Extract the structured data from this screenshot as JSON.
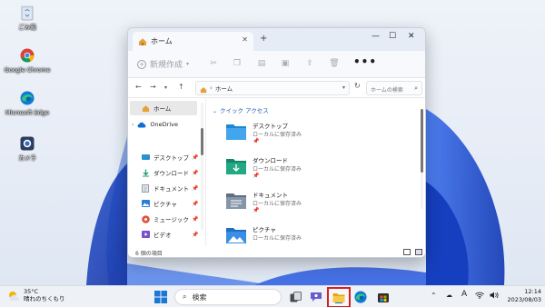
{
  "desktop_icons": [
    {
      "label": "ごみ箱",
      "icon": "recycle-bin-icon"
    },
    {
      "label": "Google Chrome",
      "icon": "chrome-icon"
    },
    {
      "label": "Microsoft Edge",
      "icon": "edge-icon"
    },
    {
      "label": "カメラ",
      "icon": "camera-icon"
    }
  ],
  "explorer": {
    "tab_title": "ホーム",
    "tab_close": "✕",
    "new_tab": "+",
    "controls": {
      "minimize": "—",
      "maximize": "☐",
      "close": "✕"
    },
    "command_bar": {
      "new_label": "新規作成",
      "more": "•••"
    },
    "address": {
      "crumb": "ホーム"
    },
    "search_placeholder": "ホームの検索",
    "nav": {
      "home": "ホーム",
      "onedrive": "OneDrive",
      "items": [
        {
          "label": "デスクトップ",
          "icon": "desktop-folder-icon",
          "color": "#2b8fd6"
        },
        {
          "label": "ダウンロード",
          "icon": "download-icon",
          "color": "#1f9e6e"
        },
        {
          "label": "ドキュメント",
          "icon": "documents-icon",
          "color": "#6c7a89"
        },
        {
          "label": "ピクチャ",
          "icon": "pictures-icon",
          "color": "#2a7fd4"
        },
        {
          "label": "ミュージック",
          "icon": "music-icon",
          "color": "#e0533c"
        },
        {
          "label": "ビデオ",
          "icon": "videos-icon",
          "color": "#7b4fc9"
        }
      ]
    },
    "content": {
      "section_title": "クイック アクセス",
      "folders": [
        {
          "name": "デスクトップ",
          "sub": "ローカルに保存済み",
          "icon": "desktop-folder-icon"
        },
        {
          "name": "ダウンロード",
          "sub": "ローカルに保存済み",
          "icon": "download-folder-icon"
        },
        {
          "name": "ドキュメント",
          "sub": "ローカルに保存済み",
          "icon": "documents-folder-icon"
        },
        {
          "name": "ピクチャ",
          "sub": "ローカルに保存済み",
          "icon": "pictures-folder-icon"
        }
      ]
    },
    "status": {
      "count": "6 個の項目"
    }
  },
  "taskbar": {
    "weather": {
      "temp": "35°C",
      "condition": "晴れのちくもり"
    },
    "search_label": "検索",
    "clock": {
      "time": "12:14",
      "date": "2023/08/03"
    },
    "ime": "A",
    "accent": "#d81e1e"
  }
}
